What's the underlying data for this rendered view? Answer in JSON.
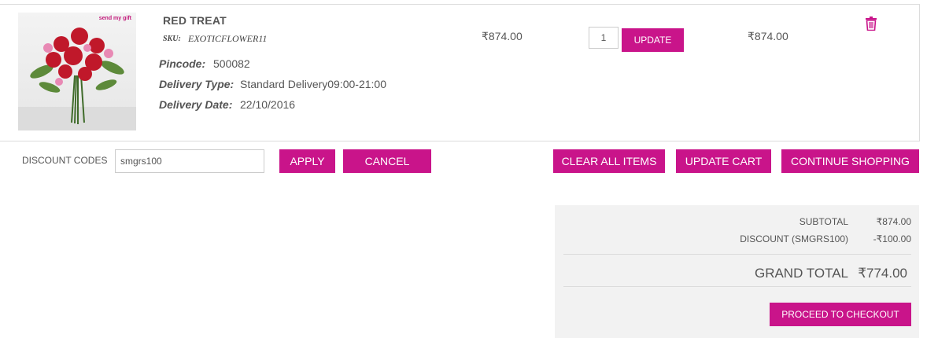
{
  "item": {
    "name": "RED TREAT",
    "sku_label": "SKU:",
    "sku": "EXOTICFLOWER11",
    "brand_logo": "send my gift",
    "pincode_label": "Pincode:",
    "pincode": "500082",
    "delivery_type_label": "Delivery Type:",
    "delivery_type": "Standard Delivery09:00-21:00",
    "delivery_date_label": "Delivery Date:",
    "delivery_date": "22/10/2016",
    "price": "₹874.00",
    "qty": "1",
    "update_label": "UPDATE",
    "total": "₹874.00",
    "delete_icon": "trash-icon"
  },
  "discount": {
    "label": "DISCOUNT CODES",
    "code": "smgrs100",
    "apply_label": "APPLY",
    "cancel_label": "CANCEL"
  },
  "actions": {
    "clear_label": "CLEAR ALL ITEMS",
    "update_cart_label": "UPDATE CART",
    "continue_label": "CONTINUE SHOPPING"
  },
  "summary": {
    "subtotal_label": "SUBTOTAL",
    "subtotal": "₹874.00",
    "discount_label": "DISCOUNT (SMGRS100)",
    "discount": "-₹100.00",
    "grand_total_label": "GRAND TOTAL",
    "grand_total": "₹774.00",
    "checkout_label": "PROCEED TO CHECKOUT"
  },
  "colors": {
    "accent": "#c9148a",
    "summary_bg": "#f2f2f2"
  }
}
